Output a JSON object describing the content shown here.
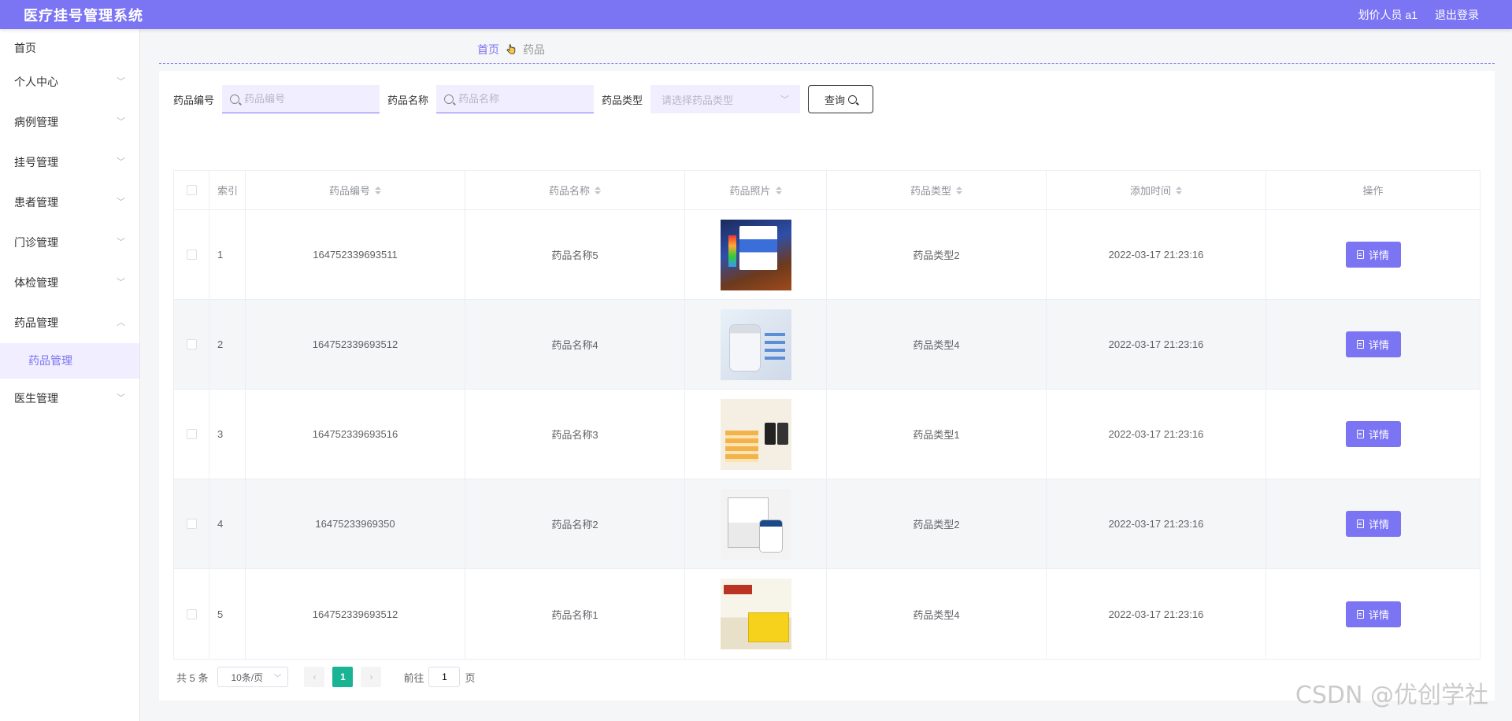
{
  "app": {
    "title": "医疗挂号管理系统",
    "user_label": "划价人员 a1",
    "logout_label": "退出登录",
    "accent_color": "#7b74f3"
  },
  "sidebar": {
    "home": "首页",
    "items": [
      {
        "label": "个人中心",
        "expanded": false
      },
      {
        "label": "病例管理",
        "expanded": false
      },
      {
        "label": "挂号管理",
        "expanded": false
      },
      {
        "label": "患者管理",
        "expanded": false
      },
      {
        "label": "门诊管理",
        "expanded": false
      },
      {
        "label": "体检管理",
        "expanded": false
      },
      {
        "label": "药品管理",
        "expanded": true,
        "sub": "药品管理"
      },
      {
        "label": "医生管理",
        "expanded": false
      }
    ]
  },
  "breadcrumb": {
    "home": "首页",
    "current": "药品"
  },
  "search": {
    "code_label": "药品编号",
    "code_placeholder": "药品编号",
    "name_label": "药品名称",
    "name_placeholder": "药品名称",
    "type_label": "药品类型",
    "type_placeholder": "请选择药品类型",
    "query_label": "查询"
  },
  "table": {
    "headers": {
      "index": "索引",
      "code": "药品编号",
      "name": "药品名称",
      "image": "药品照片",
      "type": "药品类型",
      "time": "添加时间",
      "op": "操作"
    },
    "detail_label": "详情",
    "rows": [
      {
        "index": "1",
        "code": "164752339693511",
        "name": "药品名称5",
        "type": "药品类型2",
        "time": "2022-03-17 21:23:16"
      },
      {
        "index": "2",
        "code": "164752339693512",
        "name": "药品名称4",
        "type": "药品类型4",
        "time": "2022-03-17 21:23:16"
      },
      {
        "index": "3",
        "code": "164752339693516",
        "name": "药品名称3",
        "type": "药品类型1",
        "time": "2022-03-17 21:23:16"
      },
      {
        "index": "4",
        "code": "16475233969350",
        "name": "药品名称2",
        "type": "药品类型2",
        "time": "2022-03-17 21:23:16"
      },
      {
        "index": "5",
        "code": "164752339693512",
        "name": "药品名称1",
        "type": "药品类型4",
        "time": "2022-03-17 21:23:16"
      }
    ]
  },
  "pager": {
    "total": "共 5 条",
    "page_size": "10条/页",
    "prev": "‹",
    "current_page": "1",
    "next": "›",
    "goto_label": "前往",
    "goto_value": "1",
    "page_unit": "页"
  },
  "watermark": "CSDN @优创学社"
}
